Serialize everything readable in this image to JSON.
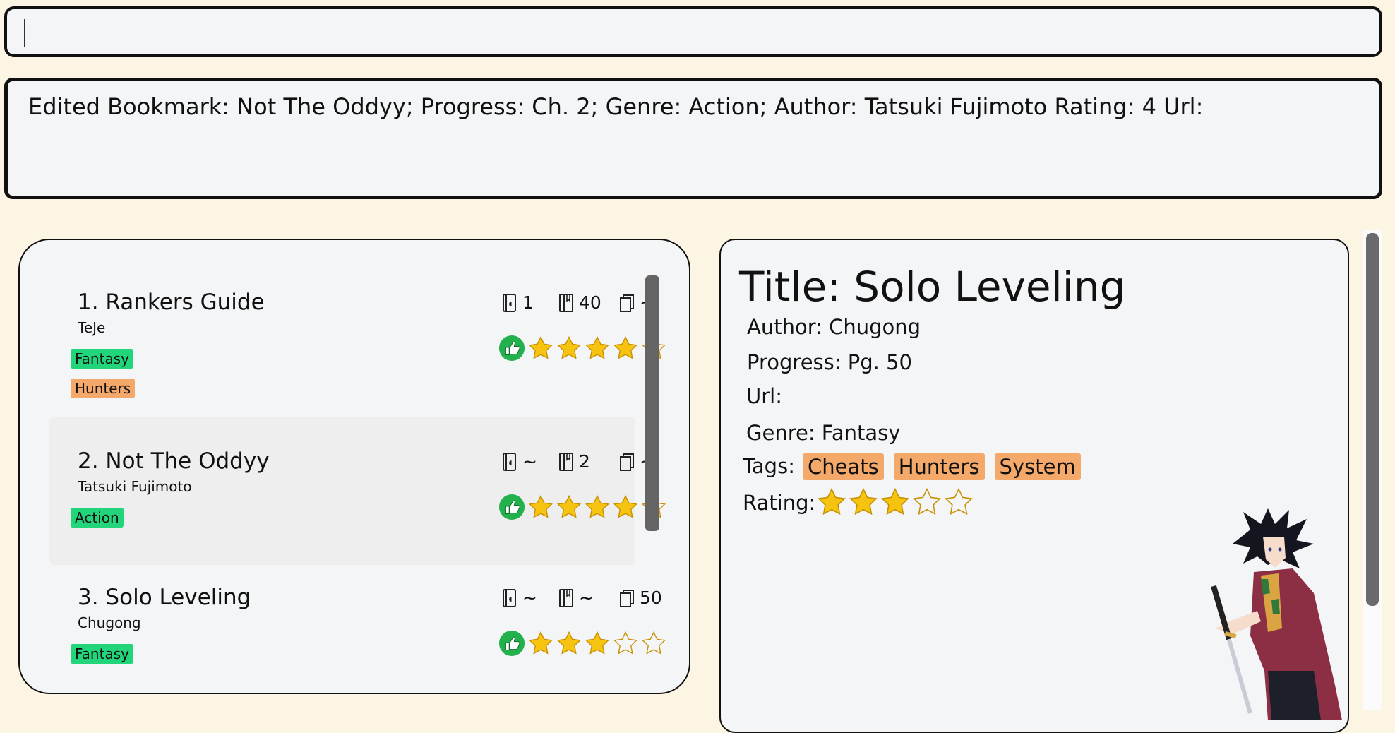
{
  "command_box": {
    "value": ""
  },
  "result_display": {
    "text": "Edited Bookmark: Not The Oddyy; Progress: Ch. 2; Genre: Action; Author: Tatsuki Fujimoto Rating: 4 Url:"
  },
  "bookmark_list": {
    "items": [
      {
        "title": "1. Rankers Guide",
        "author": "TeJe",
        "genre": "Fantasy",
        "tags": [
          "Hunters"
        ],
        "volume": "1",
        "chapter": "40",
        "page": "~",
        "rating": 4
      },
      {
        "title": "2. Not The Oddyy",
        "author": "Tatsuki Fujimoto",
        "genre": "Action",
        "tags": [],
        "volume": "~",
        "chapter": "2",
        "page": "~",
        "rating": 4
      },
      {
        "title": "3. Solo Leveling",
        "author": "Chugong",
        "genre": "Fantasy",
        "tags": [],
        "volume": "~",
        "chapter": "~",
        "page": "50",
        "rating": 3
      }
    ]
  },
  "detail": {
    "title": "Title: Solo Leveling",
    "author": "Author: Chugong",
    "progress": "Progress: Pg. 50",
    "url": "Url:",
    "genre": "Genre: Fantasy",
    "tags_label": "Tags:",
    "tags": [
      "Cheats",
      "Hunters",
      "System"
    ],
    "rating_label": "Rating:",
    "rating": 3
  },
  "colors": {
    "background": "#fdf5e4",
    "panel": "#f4f5f7",
    "genre_tag": "#22d47a",
    "tag": "#f4a86a",
    "star": "#f6c410",
    "thumb": "#22b14c"
  }
}
